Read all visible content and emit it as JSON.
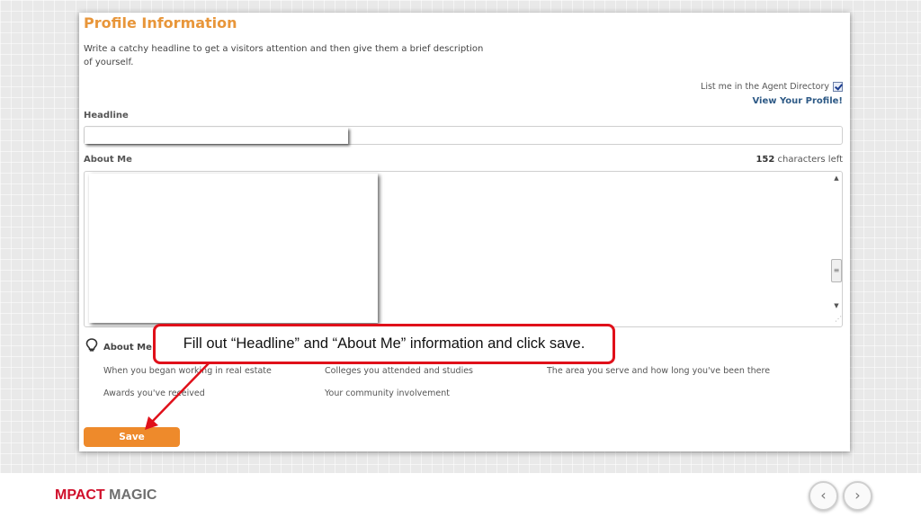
{
  "profile": {
    "title": "Profile Information",
    "description": "Write a catchy headline to get a visitors attention and then give them a brief description of yourself.",
    "agent_directory_label": "List me in the Agent Directory",
    "agent_directory_checked": true,
    "view_profile_link": "View Your Profile!",
    "headline_label": "Headline",
    "about_label": "About Me",
    "chars_left_count": "152",
    "chars_left_text": "characters left",
    "suggestions_label": "About Me S",
    "suggestions": [
      "When you began working in real estate",
      "Colleges you attended and studies",
      "The area you serve and how long you've been there",
      "Awards you've received",
      "Your community involvement"
    ],
    "save_label": "Save"
  },
  "callout": {
    "text": "Fill out “Headline” and “About Me” information and click save."
  },
  "footer": {
    "brand_part1": "MPACT",
    "brand_part2": "MAGIC",
    "prev_icon": "chevron-left-icon",
    "next_icon": "chevron-right-icon"
  },
  "colors": {
    "title": "#e8963a",
    "save_button": "#ee8a2b",
    "callout_border": "#e0101a",
    "brand_red": "#d0102b",
    "link": "#2e5a86"
  }
}
